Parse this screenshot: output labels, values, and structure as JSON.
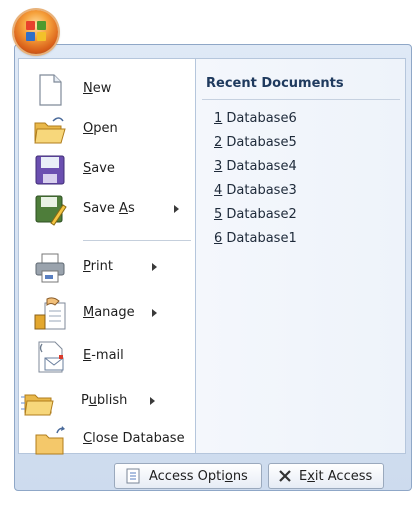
{
  "menu": {
    "items": [
      {
        "label": "New",
        "accel_index": 0,
        "icon": "new-document-icon",
        "has_submenu": false
      },
      {
        "label": "Open",
        "accel_index": 0,
        "icon": "open-folder-icon",
        "has_submenu": false
      },
      {
        "label": "Save",
        "accel_index": 0,
        "icon": "save-disk-icon",
        "has_submenu": false
      },
      {
        "label": "Save As",
        "accel_index": 5,
        "icon": "save-as-icon",
        "has_submenu": true
      },
      {
        "label": "Print",
        "accel_index": 0,
        "icon": "printer-icon",
        "has_submenu": true
      },
      {
        "label": "Manage",
        "accel_index": 0,
        "icon": "manage-database-icon",
        "has_submenu": true
      },
      {
        "label": "E-mail",
        "accel_index": 0,
        "icon": "email-icon",
        "has_submenu": false
      },
      {
        "label": "Publish",
        "accel_index": 1,
        "icon": "publish-folder-icon",
        "has_submenu": true
      },
      {
        "label": "Close Database",
        "accel_index": 0,
        "icon": "close-database-folder-icon",
        "has_submenu": false
      }
    ]
  },
  "recent": {
    "title": "Recent Documents",
    "docs": [
      {
        "num": "1",
        "name": "Database6"
      },
      {
        "num": "2",
        "name": "Database5"
      },
      {
        "num": "3",
        "name": "Database4"
      },
      {
        "num": "4",
        "name": "Database3"
      },
      {
        "num": "5",
        "name": "Database2"
      },
      {
        "num": "6",
        "name": "Database1"
      }
    ]
  },
  "footer": {
    "options": {
      "label": "Access Options",
      "accel_index": 11
    },
    "exit": {
      "label": "Exit Access",
      "accel_index": 1
    }
  },
  "colors": {
    "accent": "#1f3a5e",
    "frame": "#cddbee"
  }
}
